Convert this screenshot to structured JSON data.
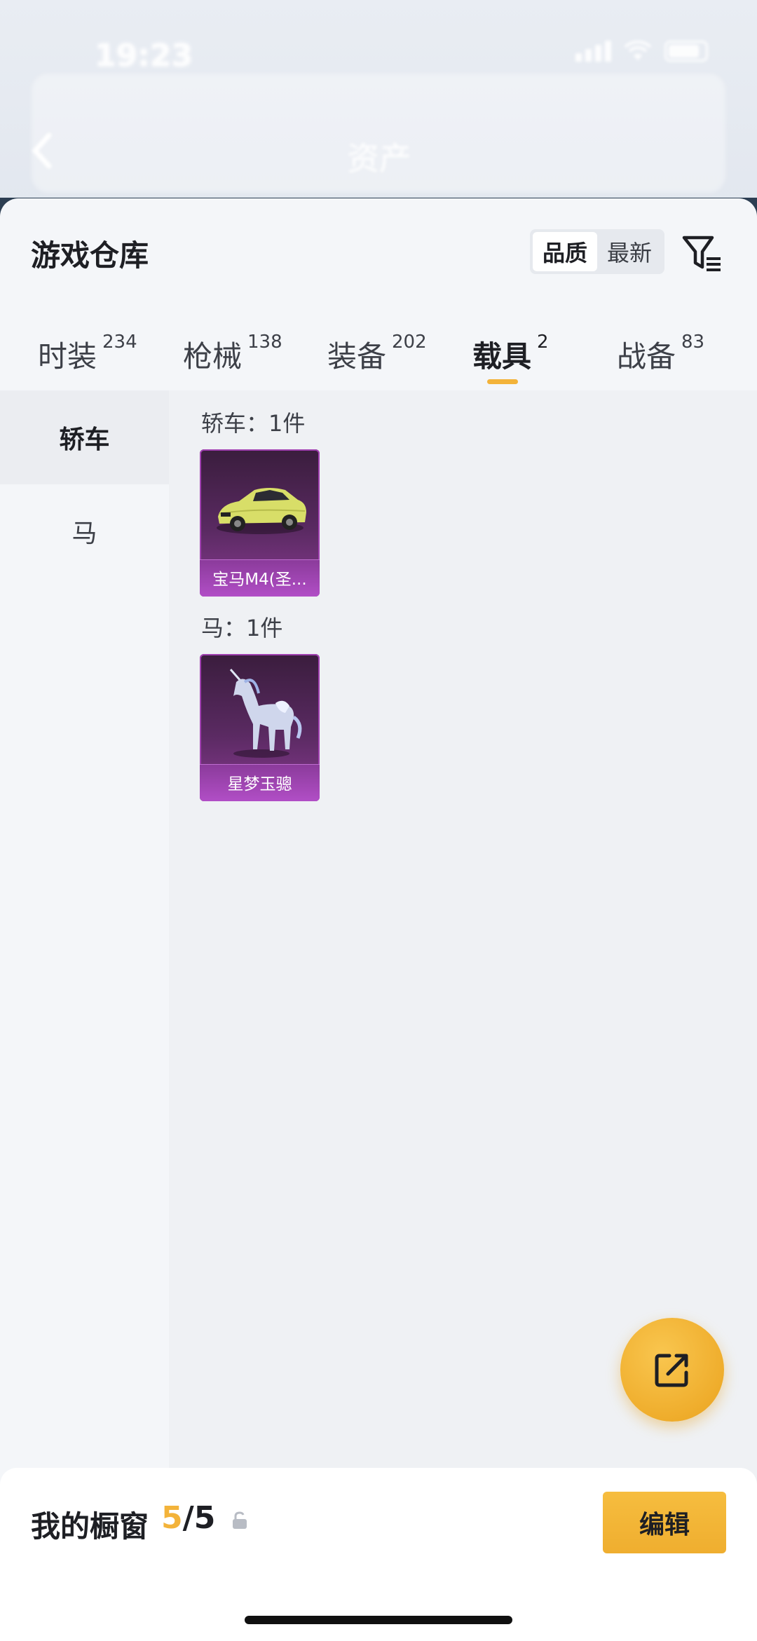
{
  "status": {
    "time": "19:23"
  },
  "background": {
    "title": "资产"
  },
  "warehouse": {
    "title": "游戏仓库",
    "sort_options": [
      "品质",
      "最新"
    ],
    "sort_selected": "品质"
  },
  "tabs": [
    {
      "label": "时装",
      "count": "234"
    },
    {
      "label": "枪械",
      "count": "138"
    },
    {
      "label": "装备",
      "count": "202"
    },
    {
      "label": "载具",
      "count": "2",
      "active": true
    },
    {
      "label": "战备",
      "count": "83"
    }
  ],
  "categories": [
    {
      "label": "轿车",
      "active": true
    },
    {
      "label": "马"
    }
  ],
  "sections": [
    {
      "title": "轿车：1件",
      "items": [
        {
          "name": "宝马M4(圣..."
        }
      ]
    },
    {
      "title": "马：1件",
      "items": [
        {
          "name": "星梦玉骢"
        }
      ]
    }
  ],
  "showcase": {
    "label": "我的橱窗",
    "current": "5",
    "separator": "/",
    "max": "5",
    "edit_label": "编辑"
  },
  "colors": {
    "accent": "#f3b33a",
    "card_purple": "#8a3a92"
  }
}
